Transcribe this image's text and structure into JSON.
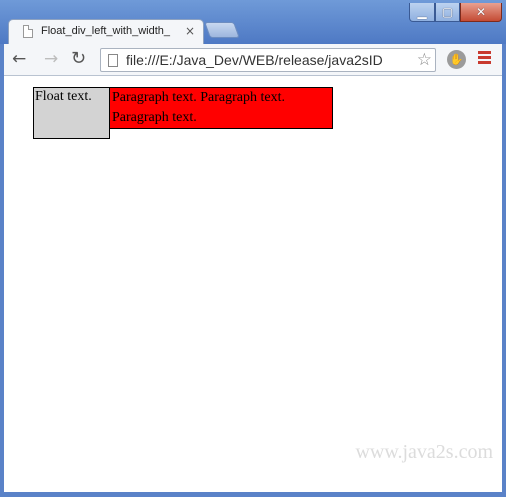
{
  "window": {
    "controls": {
      "minimize": "▁",
      "maximize": "▢",
      "close": "✕"
    }
  },
  "tab": {
    "title": "Float_div_left_with_width_",
    "close": "×"
  },
  "toolbar": {
    "back": "←",
    "forward": "→",
    "reload": "↻",
    "url": "file:///E:/Java_Dev/WEB/release/java2sID",
    "star": "☆",
    "extension": "✋"
  },
  "content": {
    "float_text": "Float text.",
    "paragraph_text": "Paragraph text. Paragraph text. Paragraph text.",
    "float_bg": "#d3d3d3",
    "paragraph_bg": "#ff0000"
  },
  "watermark": "www.java2s.com"
}
